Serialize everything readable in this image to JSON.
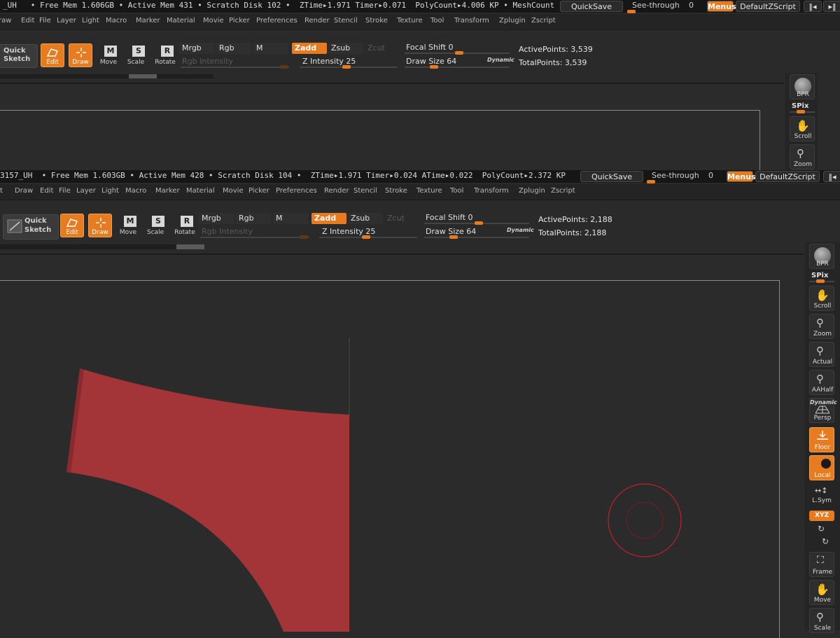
{
  "top": {
    "status": "_UH   • Free Mem 1.606GB • Active Mem 431 • Scratch Disk 102 •  ZTime▸1.971 Timer▸0.071  PolyCount▸4.006 KP • MeshCount",
    "quicksave": "QuickSave",
    "seethrough": "See-through",
    "seethrough_value": "0",
    "menus": "Menus",
    "script": "DefaultZScript",
    "menu_items": [
      "raw",
      "Edit",
      "File",
      "Layer",
      "Light",
      "Macro",
      "Marker",
      "Material",
      "Movie",
      "Picker",
      "Preferences",
      "Render",
      "Stencil",
      "Stroke",
      "Texture",
      "Tool",
      "Transform",
      "Zplugin",
      "Zscript"
    ],
    "quick_sketch": [
      "Quick",
      "Sketch"
    ],
    "tools": [
      "Edit",
      "Draw",
      "Move",
      "Scale",
      "Rotate"
    ],
    "mrgb": "Mrgb",
    "rgb": "Rgb",
    "m": "M",
    "zadd": "Zadd",
    "zsub": "Zsub",
    "zcut": "Zcut",
    "rgb_intensity": "Rgb Intensity",
    "z_intensity": "Z Intensity 25",
    "focal_shift": "Focal Shift 0",
    "draw_size": "Draw Size 64",
    "dynamic": "Dynamic",
    "active_points": "ActivePoints: 3,539",
    "total_points": "TotalPoints: 3,539",
    "right_tools": [
      "BPR",
      "SPix",
      "Scroll",
      "Zoom"
    ]
  },
  "bottom": {
    "status": "3157_UH  • Free Mem 1.603GB • Active Mem 428 • Scratch Disk 104 •  ZTime▸1.971 Timer▸0.024 ATime▸0.022  PolyCount▸2.372 KP",
    "quicksave": "QuickSave",
    "seethrough": "See-through",
    "seethrough_value": "0",
    "menus": "Menus",
    "script": "DefaultZScript",
    "menu_items": [
      "t",
      "Draw",
      "Edit",
      "File",
      "Layer",
      "Light",
      "Macro",
      "Marker",
      "Material",
      "Movie",
      "Picker",
      "Preferences",
      "Render",
      "Stencil",
      "Stroke",
      "Texture",
      "Tool",
      "Transform",
      "Zplugin",
      "Zscript"
    ],
    "quick_sketch": [
      "Quick",
      "Sketch"
    ],
    "tools": [
      "Edit",
      "Draw",
      "Move",
      "Scale",
      "Rotate"
    ],
    "mrgb": "Mrgb",
    "rgb": "Rgb",
    "m": "M",
    "zadd": "Zadd",
    "zsub": "Zsub",
    "zcut": "Zcut",
    "rgb_intensity": "Rgb Intensity",
    "z_intensity": "Z Intensity 25",
    "focal_shift": "Focal Shift 0",
    "draw_size": "Draw Size 64",
    "dynamic": "Dynamic",
    "active_points": "ActivePoints: 2,188",
    "total_points": "TotalPoints: 2,188",
    "right_tools": [
      "BPR",
      "SPix",
      "Scroll",
      "Zoom",
      "Actual",
      "AAHalf",
      "Persp",
      "Floor",
      "Local",
      "L.Sym",
      "Frame",
      "Move",
      "Scale"
    ],
    "persp_overlay": "Dynamic",
    "xyz": "XYZ"
  },
  "colors": {
    "accent": "#e77b1f",
    "mesh": "#a33438",
    "brush": "#c0202a"
  }
}
